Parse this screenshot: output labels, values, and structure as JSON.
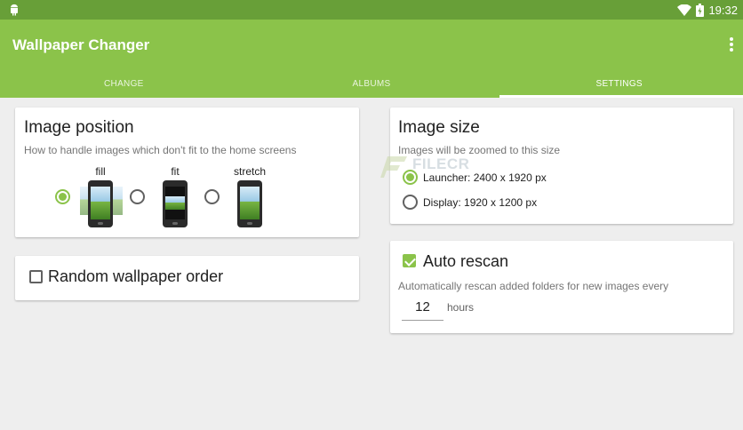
{
  "status_bar": {
    "time": "19:32",
    "icons": [
      "android-icon",
      "wifi-icon",
      "battery-icon"
    ]
  },
  "app_bar": {
    "title": "Wallpaper Changer",
    "menu_icon": "more-vert-icon"
  },
  "tabs": [
    {
      "label": "CHANGE",
      "selected": false
    },
    {
      "label": "ALBUMS",
      "selected": false
    },
    {
      "label": "SETTINGS",
      "selected": true
    }
  ],
  "image_position": {
    "title": "Image position",
    "description": "How to handle images which don't fit to the home screens",
    "options": [
      {
        "label": "fill",
        "selected": true
      },
      {
        "label": "fit",
        "selected": false
      },
      {
        "label": "stretch",
        "selected": false
      }
    ]
  },
  "random_order": {
    "label": "Random wallpaper order",
    "checked": false
  },
  "image_size": {
    "title": "Image size",
    "description": "Images will be zoomed to this size",
    "options": [
      {
        "label": "Launcher: 2400 x 1920 px",
        "selected": true
      },
      {
        "label": "Display: 1920 x 1200 px",
        "selected": false
      }
    ]
  },
  "auto_rescan": {
    "label": "Auto rescan",
    "checked": true,
    "description": "Automatically rescan added folders for new images every",
    "value": "12",
    "unit": "hours"
  },
  "watermark": {
    "text": "FILECR"
  },
  "colors": {
    "primary": "#8bc34a",
    "primary_dark": "#689f38",
    "background": "#eeeeee"
  }
}
